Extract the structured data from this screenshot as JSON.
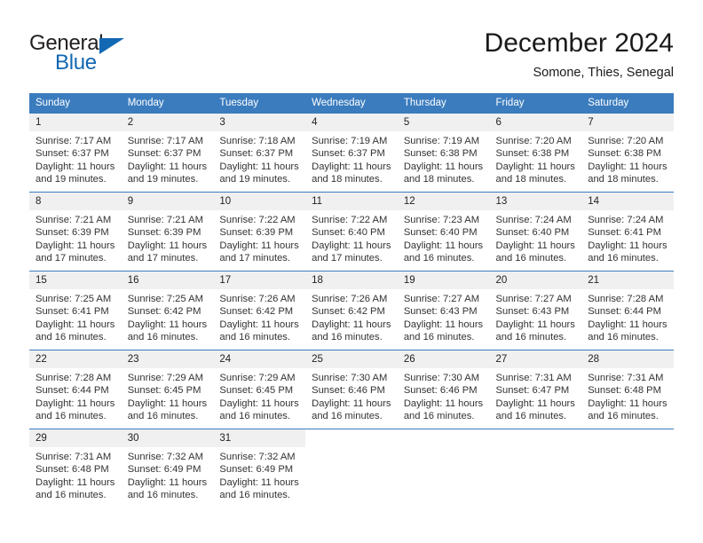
{
  "brand": {
    "name_part1": "General",
    "name_part2": "Blue",
    "triangle_icon": "triangle-icon",
    "color_dark": "#231f20",
    "color_blue": "#1268b3"
  },
  "header": {
    "title": "December 2024",
    "subtitle": "Somone, Thies, Senegal"
  },
  "calendar": {
    "header_bg": "#3b7cbe",
    "daynum_bg": "#f0f0f0",
    "weekdays": [
      "Sunday",
      "Monday",
      "Tuesday",
      "Wednesday",
      "Thursday",
      "Friday",
      "Saturday"
    ],
    "weeks": [
      [
        {
          "day": "1",
          "sunrise": "Sunrise: 7:17 AM",
          "sunset": "Sunset: 6:37 PM",
          "daylight1": "Daylight: 11 hours",
          "daylight2": "and 19 minutes."
        },
        {
          "day": "2",
          "sunrise": "Sunrise: 7:17 AM",
          "sunset": "Sunset: 6:37 PM",
          "daylight1": "Daylight: 11 hours",
          "daylight2": "and 19 minutes."
        },
        {
          "day": "3",
          "sunrise": "Sunrise: 7:18 AM",
          "sunset": "Sunset: 6:37 PM",
          "daylight1": "Daylight: 11 hours",
          "daylight2": "and 19 minutes."
        },
        {
          "day": "4",
          "sunrise": "Sunrise: 7:19 AM",
          "sunset": "Sunset: 6:37 PM",
          "daylight1": "Daylight: 11 hours",
          "daylight2": "and 18 minutes."
        },
        {
          "day": "5",
          "sunrise": "Sunrise: 7:19 AM",
          "sunset": "Sunset: 6:38 PM",
          "daylight1": "Daylight: 11 hours",
          "daylight2": "and 18 minutes."
        },
        {
          "day": "6",
          "sunrise": "Sunrise: 7:20 AM",
          "sunset": "Sunset: 6:38 PM",
          "daylight1": "Daylight: 11 hours",
          "daylight2": "and 18 minutes."
        },
        {
          "day": "7",
          "sunrise": "Sunrise: 7:20 AM",
          "sunset": "Sunset: 6:38 PM",
          "daylight1": "Daylight: 11 hours",
          "daylight2": "and 18 minutes."
        }
      ],
      [
        {
          "day": "8",
          "sunrise": "Sunrise: 7:21 AM",
          "sunset": "Sunset: 6:39 PM",
          "daylight1": "Daylight: 11 hours",
          "daylight2": "and 17 minutes."
        },
        {
          "day": "9",
          "sunrise": "Sunrise: 7:21 AM",
          "sunset": "Sunset: 6:39 PM",
          "daylight1": "Daylight: 11 hours",
          "daylight2": "and 17 minutes."
        },
        {
          "day": "10",
          "sunrise": "Sunrise: 7:22 AM",
          "sunset": "Sunset: 6:39 PM",
          "daylight1": "Daylight: 11 hours",
          "daylight2": "and 17 minutes."
        },
        {
          "day": "11",
          "sunrise": "Sunrise: 7:22 AM",
          "sunset": "Sunset: 6:40 PM",
          "daylight1": "Daylight: 11 hours",
          "daylight2": "and 17 minutes."
        },
        {
          "day": "12",
          "sunrise": "Sunrise: 7:23 AM",
          "sunset": "Sunset: 6:40 PM",
          "daylight1": "Daylight: 11 hours",
          "daylight2": "and 16 minutes."
        },
        {
          "day": "13",
          "sunrise": "Sunrise: 7:24 AM",
          "sunset": "Sunset: 6:40 PM",
          "daylight1": "Daylight: 11 hours",
          "daylight2": "and 16 minutes."
        },
        {
          "day": "14",
          "sunrise": "Sunrise: 7:24 AM",
          "sunset": "Sunset: 6:41 PM",
          "daylight1": "Daylight: 11 hours",
          "daylight2": "and 16 minutes."
        }
      ],
      [
        {
          "day": "15",
          "sunrise": "Sunrise: 7:25 AM",
          "sunset": "Sunset: 6:41 PM",
          "daylight1": "Daylight: 11 hours",
          "daylight2": "and 16 minutes."
        },
        {
          "day": "16",
          "sunrise": "Sunrise: 7:25 AM",
          "sunset": "Sunset: 6:42 PM",
          "daylight1": "Daylight: 11 hours",
          "daylight2": "and 16 minutes."
        },
        {
          "day": "17",
          "sunrise": "Sunrise: 7:26 AM",
          "sunset": "Sunset: 6:42 PM",
          "daylight1": "Daylight: 11 hours",
          "daylight2": "and 16 minutes."
        },
        {
          "day": "18",
          "sunrise": "Sunrise: 7:26 AM",
          "sunset": "Sunset: 6:42 PM",
          "daylight1": "Daylight: 11 hours",
          "daylight2": "and 16 minutes."
        },
        {
          "day": "19",
          "sunrise": "Sunrise: 7:27 AM",
          "sunset": "Sunset: 6:43 PM",
          "daylight1": "Daylight: 11 hours",
          "daylight2": "and 16 minutes."
        },
        {
          "day": "20",
          "sunrise": "Sunrise: 7:27 AM",
          "sunset": "Sunset: 6:43 PM",
          "daylight1": "Daylight: 11 hours",
          "daylight2": "and 16 minutes."
        },
        {
          "day": "21",
          "sunrise": "Sunrise: 7:28 AM",
          "sunset": "Sunset: 6:44 PM",
          "daylight1": "Daylight: 11 hours",
          "daylight2": "and 16 minutes."
        }
      ],
      [
        {
          "day": "22",
          "sunrise": "Sunrise: 7:28 AM",
          "sunset": "Sunset: 6:44 PM",
          "daylight1": "Daylight: 11 hours",
          "daylight2": "and 16 minutes."
        },
        {
          "day": "23",
          "sunrise": "Sunrise: 7:29 AM",
          "sunset": "Sunset: 6:45 PM",
          "daylight1": "Daylight: 11 hours",
          "daylight2": "and 16 minutes."
        },
        {
          "day": "24",
          "sunrise": "Sunrise: 7:29 AM",
          "sunset": "Sunset: 6:45 PM",
          "daylight1": "Daylight: 11 hours",
          "daylight2": "and 16 minutes."
        },
        {
          "day": "25",
          "sunrise": "Sunrise: 7:30 AM",
          "sunset": "Sunset: 6:46 PM",
          "daylight1": "Daylight: 11 hours",
          "daylight2": "and 16 minutes."
        },
        {
          "day": "26",
          "sunrise": "Sunrise: 7:30 AM",
          "sunset": "Sunset: 6:46 PM",
          "daylight1": "Daylight: 11 hours",
          "daylight2": "and 16 minutes."
        },
        {
          "day": "27",
          "sunrise": "Sunrise: 7:31 AM",
          "sunset": "Sunset: 6:47 PM",
          "daylight1": "Daylight: 11 hours",
          "daylight2": "and 16 minutes."
        },
        {
          "day": "28",
          "sunrise": "Sunrise: 7:31 AM",
          "sunset": "Sunset: 6:48 PM",
          "daylight1": "Daylight: 11 hours",
          "daylight2": "and 16 minutes."
        }
      ],
      [
        {
          "day": "29",
          "sunrise": "Sunrise: 7:31 AM",
          "sunset": "Sunset: 6:48 PM",
          "daylight1": "Daylight: 11 hours",
          "daylight2": "and 16 minutes."
        },
        {
          "day": "30",
          "sunrise": "Sunrise: 7:32 AM",
          "sunset": "Sunset: 6:49 PM",
          "daylight1": "Daylight: 11 hours",
          "daylight2": "and 16 minutes."
        },
        {
          "day": "31",
          "sunrise": "Sunrise: 7:32 AM",
          "sunset": "Sunset: 6:49 PM",
          "daylight1": "Daylight: 11 hours",
          "daylight2": "and 16 minutes."
        },
        null,
        null,
        null,
        null
      ]
    ]
  }
}
